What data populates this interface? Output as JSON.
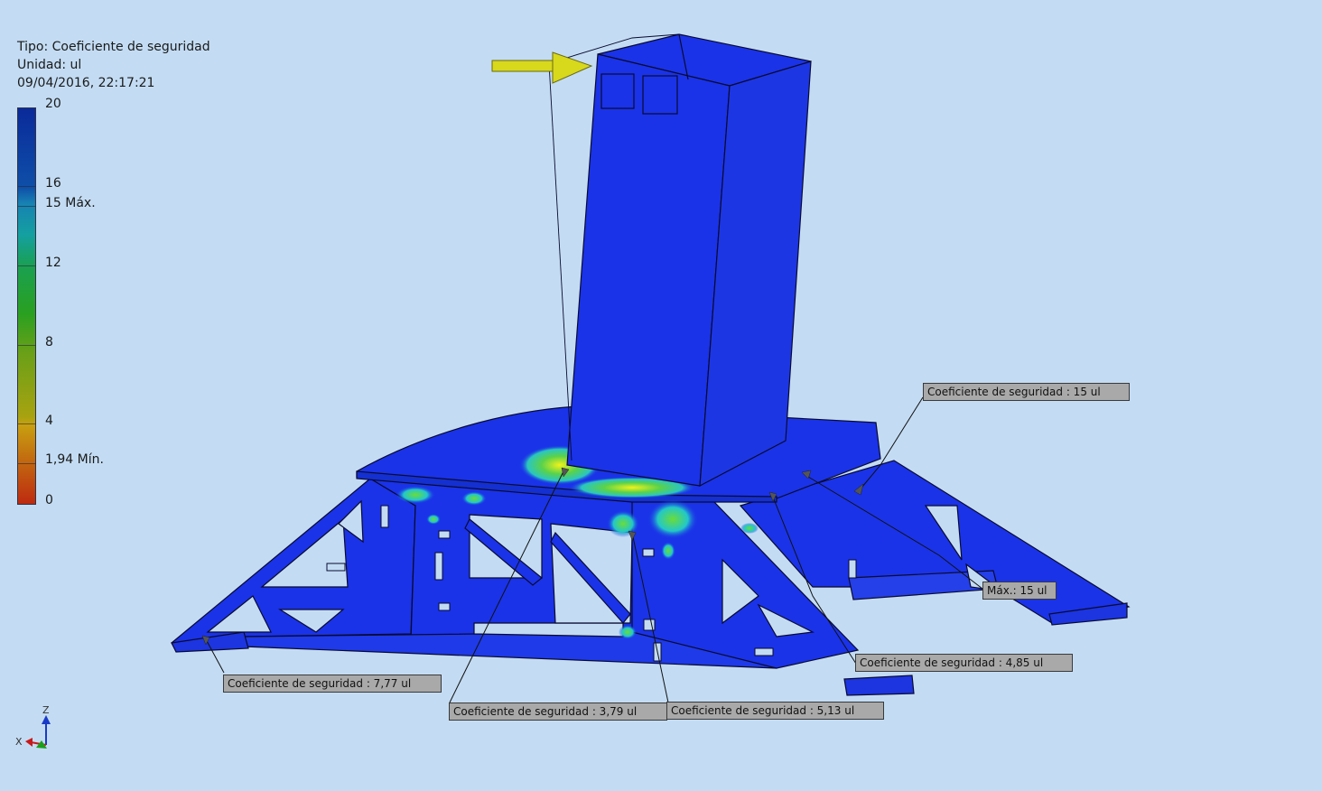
{
  "header": {
    "type_line": "Tipo: Coeficiente de seguridad",
    "unit_line": "Unidad: ul",
    "timestamp": "09/04/2016, 22:17:21"
  },
  "legend": {
    "ticks": [
      "20",
      "16",
      "15 Máx.",
      "12",
      "8",
      "4",
      "1,94 Mín.",
      "0"
    ]
  },
  "probes": [
    "Coeficiente de seguridad : 15 ul",
    "Máx.: 15 ul",
    "Coeficiente de seguridad : 4,85 ul",
    "Coeficiente de seguridad : 7,77 ul",
    "Coeficiente de seguridad : 3,79 ul",
    "Coeficiente de seguridad : 5,13 ul"
  ],
  "triad": {
    "z_label": "Z",
    "x_label": "X"
  },
  "colors": {
    "background": "#c3dcf3",
    "model_blue": "#1a33e8",
    "load_arrow": "#d8d81c"
  }
}
